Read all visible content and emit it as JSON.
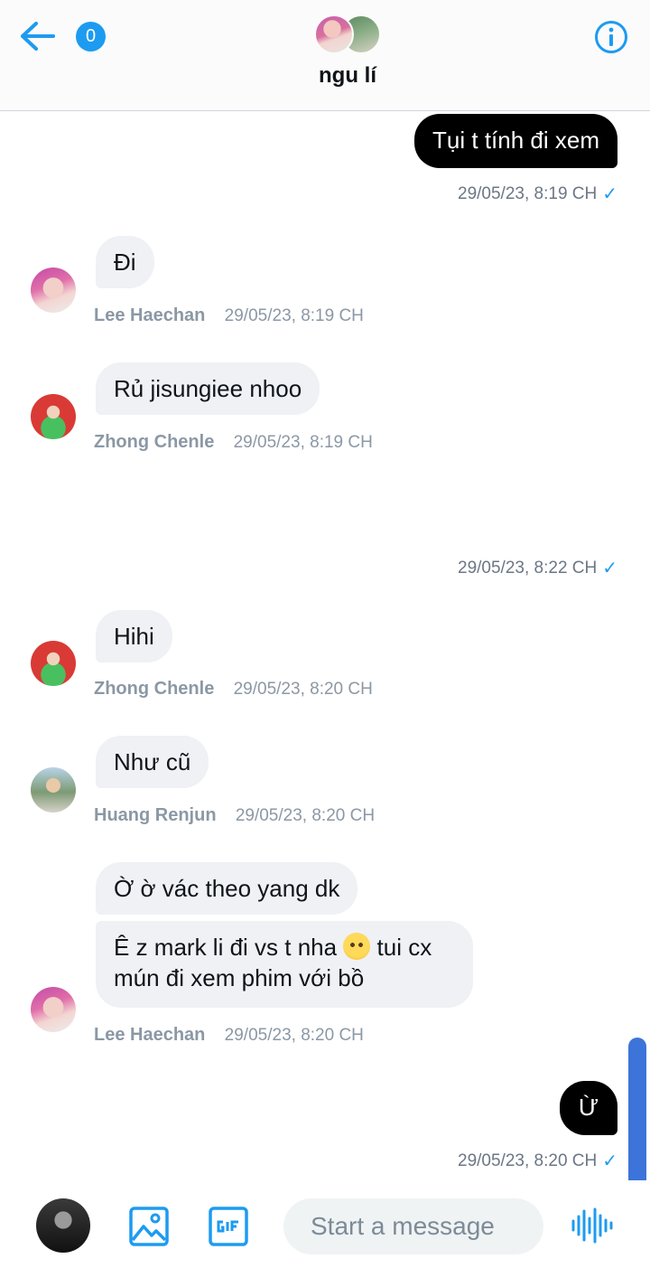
{
  "header": {
    "unread_count": "0",
    "title": "ngu lí"
  },
  "messages": {
    "m1": {
      "text": "Tụi t tính đi xem",
      "time": "29/05/23, 8:19 CH"
    },
    "m2": {
      "text": "Đi",
      "sender": "Lee Haechan",
      "time": "29/05/23, 8:19 CH"
    },
    "m3": {
      "text": "Rủ jisungiee nhoo",
      "sender": "Zhong Chenle",
      "time": "29/05/23, 8:19 CH"
    },
    "m4": {
      "time": "29/05/23, 8:22 CH"
    },
    "m5": {
      "text": "Hihi",
      "sender": "Zhong Chenle",
      "time": "29/05/23, 8:20 CH"
    },
    "m6": {
      "text": "Như cũ",
      "sender": "Huang Renjun",
      "time": "29/05/23, 8:20 CH"
    },
    "m7": {
      "text": "Ờ ờ vác theo yang dk"
    },
    "m8": {
      "text_a": "Ê z mark li đi vs t nha",
      "text_b": "tui cx",
      "text_c": "mún đi xem phim với bồ",
      "sender": "Lee Haechan",
      "time": "29/05/23, 8:20 CH"
    },
    "m9": {
      "text": "Ừ",
      "time": "29/05/23, 8:20 CH"
    }
  },
  "composer": {
    "placeholder": "Start a message"
  },
  "icons": {
    "back": "arrow-left-icon",
    "info": "info-icon",
    "image": "image-icon",
    "gif": "gif-icon",
    "voice": "voice-waveform-icon",
    "read": "check-icon",
    "emoji": "pleading-face-emoji"
  },
  "colors": {
    "accent": "#1d9bf0",
    "outgoing_bubble": "#000000",
    "incoming_bubble": "#eff1f4",
    "scrollbar": "#3d74d9"
  }
}
